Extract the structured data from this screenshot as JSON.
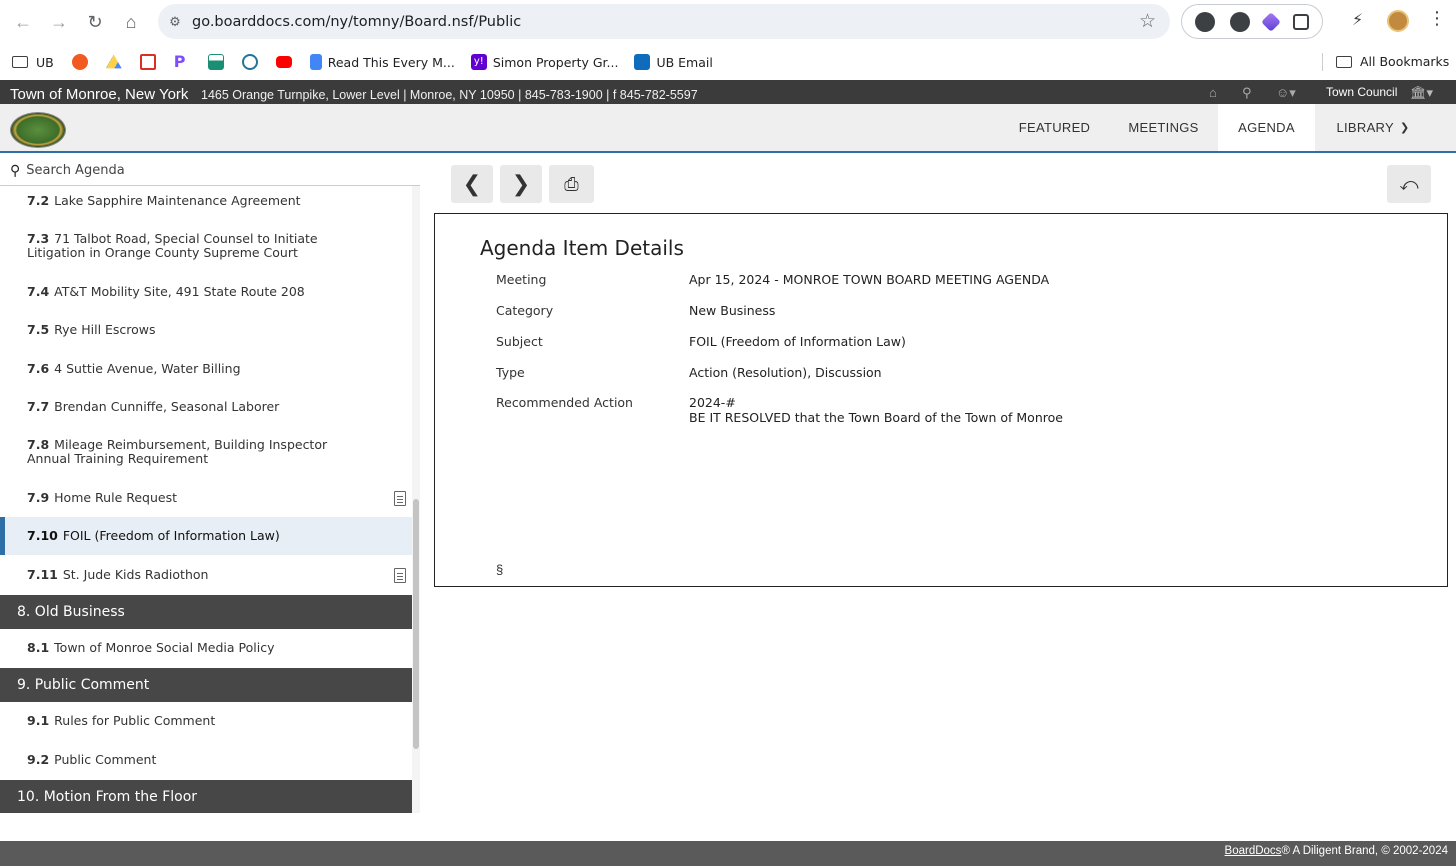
{
  "browser": {
    "url": "go.boarddocs.com/ny/tomny/Board.nsf/Public",
    "bookmarks": [
      {
        "label": "UB",
        "icon": "folder-icon"
      },
      {
        "label": "",
        "icon": "orange-sun-icon",
        "color": "#f25a22"
      },
      {
        "label": "",
        "icon": "google-drive-icon",
        "color": "#1fa463"
      },
      {
        "label": "",
        "icon": "gmail-icon",
        "color": "#d93025"
      },
      {
        "label": "",
        "icon": "p-icon",
        "color": "#7c4dff"
      },
      {
        "label": "",
        "icon": "landscape-icon",
        "color": "#1a8f73"
      },
      {
        "label": "",
        "icon": "wordpress-icon",
        "color": "#21759b"
      },
      {
        "label": "",
        "icon": "youtube-icon",
        "color": "#ff0000"
      },
      {
        "label": "Read This Every M...",
        "icon": "google-docs-icon",
        "color": "#4285f4"
      },
      {
        "label": "Simon Property Gr...",
        "icon": "yahoo-icon",
        "color": "#6001d2"
      },
      {
        "label": "UB Email",
        "icon": "outlook-icon",
        "color": "#0f6cbd"
      }
    ],
    "all_bookmarks_label": "All Bookmarks"
  },
  "header": {
    "org_name": "Town of Monroe, New York",
    "address": "1465 Orange Turnpike, Lower Level | Monroe, NY 10950 | 845-783-1900 | f 845-782-5597",
    "council": "Town Council"
  },
  "nav": {
    "tabs": [
      "FEATURED",
      "MEETINGS",
      "AGENDA",
      "LIBRARY"
    ],
    "active": "AGENDA"
  },
  "sidebar": {
    "search_placeholder": "Search Agenda",
    "items": [
      {
        "num": "7.2",
        "title": "Lake Sapphire Maintenance Agreement",
        "doc": false
      },
      {
        "num": "7.3",
        "title": "71 Talbot Road, Special Counsel to Initiate Litigation in Orange County Supreme Court",
        "doc": false
      },
      {
        "num": "7.4",
        "title": "AT&T Mobility Site, 491 State Route 208",
        "doc": false
      },
      {
        "num": "7.5",
        "title": "Rye Hill Escrows",
        "doc": false
      },
      {
        "num": "7.6",
        "title": "4 Suttie Avenue, Water Billing",
        "doc": false
      },
      {
        "num": "7.7",
        "title": "Brendan Cunniffe, Seasonal Laborer",
        "doc": false
      },
      {
        "num": "7.8",
        "title": "Mileage Reimbursement, Building Inspector Annual Training Requirement",
        "doc": false
      },
      {
        "num": "7.9",
        "title": "Home Rule Request",
        "doc": true
      },
      {
        "num": "7.10",
        "title": "FOIL (Freedom of Information Law)",
        "doc": false,
        "active": true
      },
      {
        "num": "7.11",
        "title": "St. Jude Kids Radiothon",
        "doc": true
      }
    ],
    "sections": [
      {
        "title": "8. Old Business",
        "items": [
          {
            "num": "8.1",
            "title": "Town of Monroe Social Media Policy"
          }
        ]
      },
      {
        "title": "9. Public Comment",
        "items": [
          {
            "num": "9.1",
            "title": "Rules for Public Comment"
          },
          {
            "num": "9.2",
            "title": "Public Comment"
          }
        ]
      },
      {
        "title": "10. Motion From the Floor",
        "items": []
      }
    ]
  },
  "details": {
    "title": "Agenda Item Details",
    "rows": [
      {
        "label": "Meeting",
        "value": "Apr 15, 2024 - MONROE TOWN BOARD MEETING AGENDA"
      },
      {
        "label": "Category",
        "value": "New Business"
      },
      {
        "label": "Subject",
        "value": "FOIL (Freedom of Information Law)"
      },
      {
        "label": "Type",
        "value": "Action (Resolution), Discussion"
      },
      {
        "label": "Recommended Action",
        "value": "2024-#",
        "value2": "BE IT RESOLVED that the Town Board of the Town of Monroe"
      }
    ],
    "section_mark": "§"
  },
  "footer": {
    "brand_link": "BoardDocs",
    "text": "® A Diligent Brand, © 2002-2024"
  }
}
